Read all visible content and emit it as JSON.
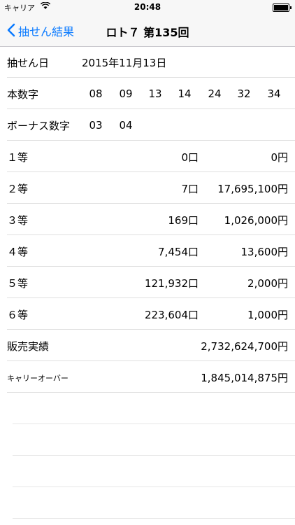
{
  "status": {
    "carrier": "キャリア",
    "time": "20:48",
    "battery_level": 1.0
  },
  "nav": {
    "back_label": "抽せん結果",
    "title": "ロト７ 第135回"
  },
  "draw_date": {
    "label": "抽せん日",
    "value": "2015年11月13日"
  },
  "main_numbers": {
    "label": "本数字",
    "values": [
      "08",
      "09",
      "13",
      "14",
      "24",
      "32",
      "34"
    ]
  },
  "bonus_numbers": {
    "label": "ボーナス数字",
    "values": [
      "03",
      "04"
    ]
  },
  "prizes": [
    {
      "label": "１等",
      "count": "0口",
      "amount": "0円"
    },
    {
      "label": "２等",
      "count": "7口",
      "amount": "17,695,100円"
    },
    {
      "label": "３等",
      "count": "169口",
      "amount": "1,026,000円"
    },
    {
      "label": "４等",
      "count": "7,454口",
      "amount": "13,600円"
    },
    {
      "label": "５等",
      "count": "121,932口",
      "amount": "2,000円"
    },
    {
      "label": "６等",
      "count": "223,604口",
      "amount": "1,000円"
    }
  ],
  "sales": {
    "label": "販売実績",
    "value": "2,732,624,700円"
  },
  "carryover": {
    "label": "キャリーオーバー",
    "value": "1,845,014,875円"
  }
}
